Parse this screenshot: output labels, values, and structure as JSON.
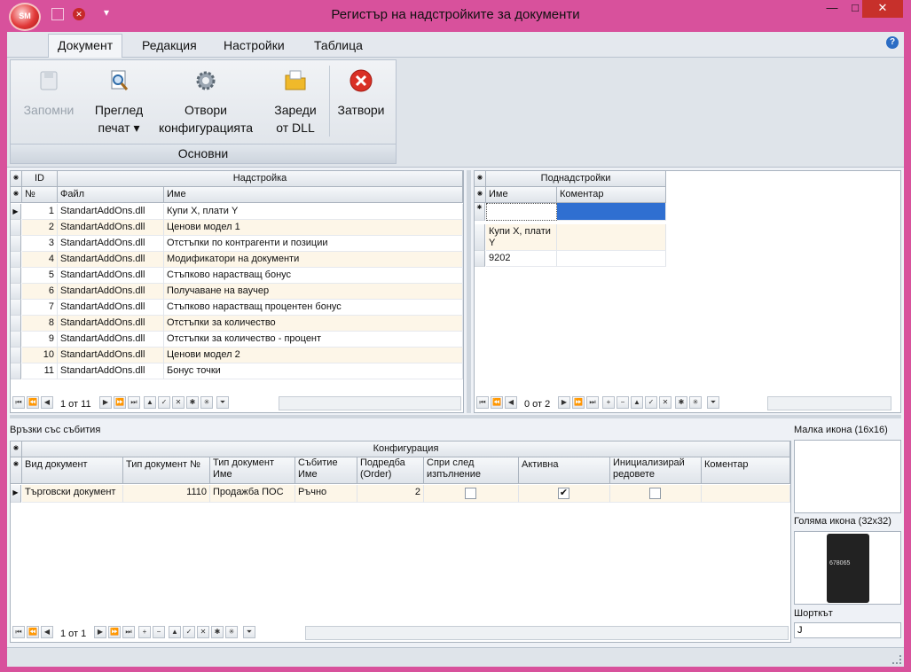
{
  "window": {
    "title": "Регистър на надстройките за документи",
    "app_badge": "SM",
    "min_glyph": "—",
    "max_glyph": "□",
    "close_glyph": "✕",
    "qat_glyph": "▾"
  },
  "ribbon": {
    "tabs": [
      "Документ",
      "Редакция",
      "Настройки",
      "Таблица"
    ],
    "active_tab": "Документ",
    "help_glyph": "?",
    "group_label": "Основни",
    "buttons": {
      "save": "Запомни",
      "preview_line1": "Преглед",
      "preview_line2": "печат ▾",
      "open_config_line1": "Отвори",
      "open_config_line2": "конфигурацията",
      "load_dll_line1": "Зареди",
      "load_dll_line2": "от DLL",
      "close": "Затвори"
    }
  },
  "addons_grid": {
    "band_id": "ID",
    "band_title": "Надстройка",
    "col_no": "№",
    "col_file": "Файл",
    "col_name": "Име",
    "rows": [
      {
        "no": "1",
        "file": "StandartAddOns.dll",
        "name": "Купи X, плати Y"
      },
      {
        "no": "2",
        "file": "StandartAddOns.dll",
        "name": "Ценови модел 1"
      },
      {
        "no": "3",
        "file": "StandartAddOns.dll",
        "name": "Отстъпки по контрагенти и позиции"
      },
      {
        "no": "4",
        "file": "StandartAddOns.dll",
        "name": "Модификатори на документи"
      },
      {
        "no": "5",
        "file": "StandartAddOns.dll",
        "name": "Стъпково нарастващ бонус"
      },
      {
        "no": "6",
        "file": "StandartAddOns.dll",
        "name": "Получаване на ваучер"
      },
      {
        "no": "7",
        "file": "StandartAddOns.dll",
        "name": "Стъпково нарастващ процентен бонус"
      },
      {
        "no": "8",
        "file": "StandartAddOns.dll",
        "name": "Отстъпки за количество"
      },
      {
        "no": "9",
        "file": "StandartAddOns.dll",
        "name": "Отстъпки за количество - процент"
      },
      {
        "no": "10",
        "file": "StandartAddOns.dll",
        "name": "Ценови модел 2"
      },
      {
        "no": "11",
        "file": "StandartAddOns.dll",
        "name": "Бонус точки"
      }
    ],
    "pager": "1 от 11"
  },
  "subaddons_grid": {
    "band_title": "Поднадстройки",
    "col_name": "Име",
    "col_comment": "Коментар",
    "row1_name_line1": "Купи X, плати",
    "row1_name_line2": "Y",
    "row2_name": "9202",
    "pager": "0 от 2"
  },
  "events": {
    "section_label": "Връзки със събития",
    "band_title": "Конфигурация",
    "columns": {
      "doc_kind": "Вид документ",
      "doc_type_no": "Тип документ №",
      "doc_type_name_1": "Тип документ",
      "doc_type_name_2": "Име",
      "event_1": "Събитие",
      "event_2": "Име",
      "order_1": "Подредба",
      "order_2": "(Order)",
      "stop_1": "Спри след",
      "stop_2": "изпълнение",
      "active": "Активна",
      "init_1": "Инициализирай",
      "init_2": "редовете",
      "comment": "Коментар"
    },
    "row": {
      "doc_kind": "Търговски документ",
      "doc_type_no": "1110",
      "doc_type_name": "Продажба ПОС",
      "event": "Ръчно",
      "order": "2",
      "stop_after": false,
      "active": true,
      "init_rows": false
    },
    "pager": "1 от 1"
  },
  "side": {
    "small_icon_label": "Малка икона (16x16)",
    "large_icon_label": "Голяма икона (32x32)",
    "shortcut_label": "Шорткът",
    "shortcut_value": "J",
    "phone_text": "678065"
  }
}
